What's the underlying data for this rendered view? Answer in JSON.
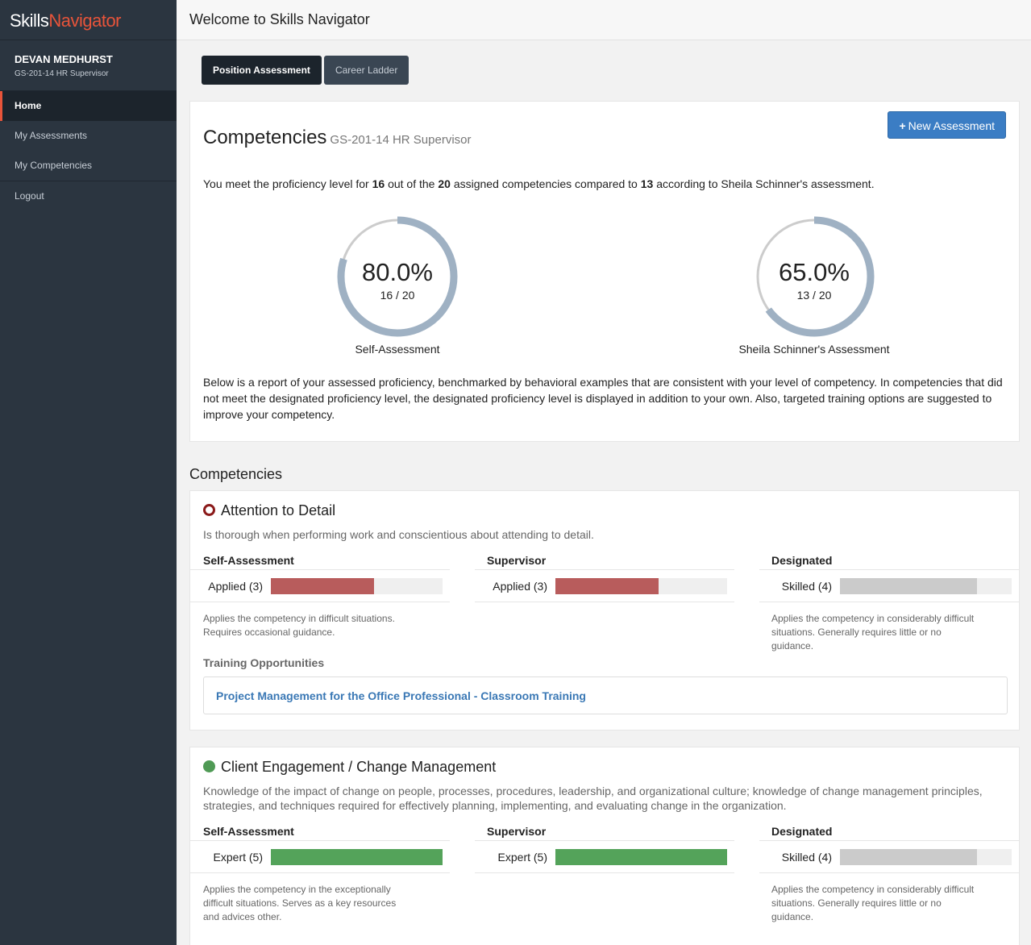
{
  "app": {
    "logo_part1": "Skills",
    "logo_part2": "Navigator",
    "page_title": "Welcome to Skills Navigator"
  },
  "user": {
    "name": "DEVAN MEDHURST",
    "role": "GS-201-14 HR Supervisor"
  },
  "sidebar": {
    "items": [
      {
        "label": "Home",
        "active": true
      },
      {
        "label": "My Assessments"
      },
      {
        "label": "My Competencies"
      },
      {
        "label": "Logout"
      }
    ]
  },
  "tabs": [
    {
      "label": "Position Assessment",
      "active": true
    },
    {
      "label": "Career Ladder"
    }
  ],
  "competencies_panel": {
    "title": "Competencies",
    "subtitle": "GS-201-14 HR Supervisor",
    "new_button": "New Assessment",
    "summary": {
      "t1": "You meet the proficiency level for ",
      "met": "16",
      "t2": " out of the ",
      "total": "20",
      "t3": " assigned competencies compared to ",
      "other_met": "13",
      "t4": " according to Sheila Schinner's assessment."
    },
    "rings": [
      {
        "percent_text": "80.0%",
        "fraction_text": "16 / 20",
        "label": "Self-Assessment",
        "value": 0.8
      },
      {
        "percent_text": "65.0%",
        "fraction_text": "13 / 20",
        "label": "Sheila Schinner's Assessment",
        "value": 0.65
      }
    ],
    "report": "Below is a report of your assessed proficiency, benchmarked by behavioral examples that are consistent with your level of competency. In competencies that did not meet the designated proficiency level, the designated proficiency level is displayed in addition to your own. Also, targeted training options are suggested to improve your competency."
  },
  "section_title": "Competencies",
  "competencies": [
    {
      "status": "not-met",
      "title": "Attention to Detail",
      "description": "Is thorough when performing work and conscientious about attending to detail.",
      "columns": [
        {
          "head": "Self-Assessment",
          "level": "Applied (3)",
          "value": 0.6,
          "color": "#b85c5c",
          "desc": "Applies the competency in difficult situations. Requires occasional guidance."
        },
        {
          "head": "Supervisor",
          "level": "Applied (3)",
          "value": 0.6,
          "color": "#b85c5c",
          "desc": ""
        },
        {
          "head": "Designated",
          "level": "Skilled (4)",
          "value": 0.8,
          "color": "#cbcbcb",
          "desc": "Applies the competency in considerably difficult situations. Generally requires little or no guidance."
        }
      ],
      "training_title": "Training Opportunities",
      "training_link": "Project Management for the Office Professional - Classroom Training"
    },
    {
      "status": "met",
      "title": "Client Engagement / Change Management",
      "description": "Knowledge of the impact of change on people, processes, procedures, leadership, and organizational culture; knowledge of change management principles, strategies, and techniques required for effectively planning, implementing, and evaluating change in the organization.",
      "columns": [
        {
          "head": "Self-Assessment",
          "level": "Expert (5)",
          "value": 1.0,
          "color": "#54a35a",
          "desc": "Applies the competency in the exceptionally difficult situations. Serves as a key resources and advices other."
        },
        {
          "head": "Supervisor",
          "level": "Expert (5)",
          "value": 1.0,
          "color": "#54a35a",
          "desc": ""
        },
        {
          "head": "Designated",
          "level": "Skilled (4)",
          "value": 0.8,
          "color": "#cbcbcb",
          "desc": "Applies the competency in considerably difficult situations. Generally requires little or no guidance."
        }
      ]
    }
  ],
  "colors": {
    "accent": "#e8543a",
    "sidebar": "#2b3540",
    "button": "#3b7dc4",
    "ring": "#9fb1c3",
    "ring_track": "#cccccc"
  }
}
